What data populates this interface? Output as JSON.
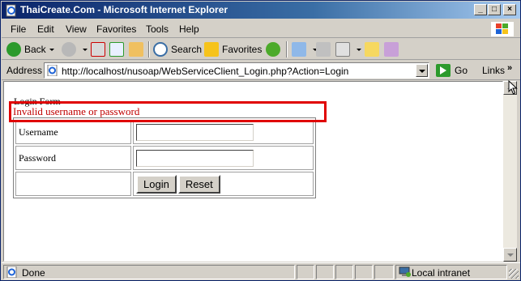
{
  "window": {
    "title": "ThaiCreate.Com - Microsoft Internet Explorer",
    "controls": {
      "minimize": "_",
      "maximize": "□",
      "close": "×"
    }
  },
  "menubar": {
    "items": [
      {
        "label": "File"
      },
      {
        "label": "Edit"
      },
      {
        "label": "View"
      },
      {
        "label": "Favorites"
      },
      {
        "label": "Tools"
      },
      {
        "label": "Help"
      }
    ]
  },
  "toolbar": {
    "back_label": "Back",
    "search_label": "Search",
    "favorites_label": "Favorites"
  },
  "addressbar": {
    "label": "Address",
    "url": "http://localhost/nusoap/WebServiceClient_Login.php?Action=Login",
    "go_label": "Go",
    "links_label": "Links",
    "chevron": "»"
  },
  "page": {
    "heading": "Login Form",
    "error": "Invalid username or password",
    "form": {
      "username_label": "Username",
      "username_value": "",
      "password_label": "Password",
      "password_value": "",
      "login_button": "Login",
      "reset_button": "Reset"
    }
  },
  "statusbar": {
    "status": "Done",
    "zone": "Local intranet"
  },
  "colors": {
    "title_gradient_start": "#0a246a",
    "error_text": "#c00000",
    "error_border": "#e00000",
    "chrome": "#d4d0c8"
  },
  "icons": {
    "title": "ie-page-icon",
    "back": "back-arrow-icon",
    "forward": "forward-arrow-icon",
    "stop": "stop-icon",
    "refresh": "refresh-icon",
    "home": "home-icon",
    "search": "search-icon",
    "favorites": "star-icon",
    "history": "history-icon",
    "mail": "mail-icon",
    "print": "print-icon",
    "edit": "edit-icon",
    "folder": "folder-icon",
    "messenger": "messenger-icon"
  }
}
